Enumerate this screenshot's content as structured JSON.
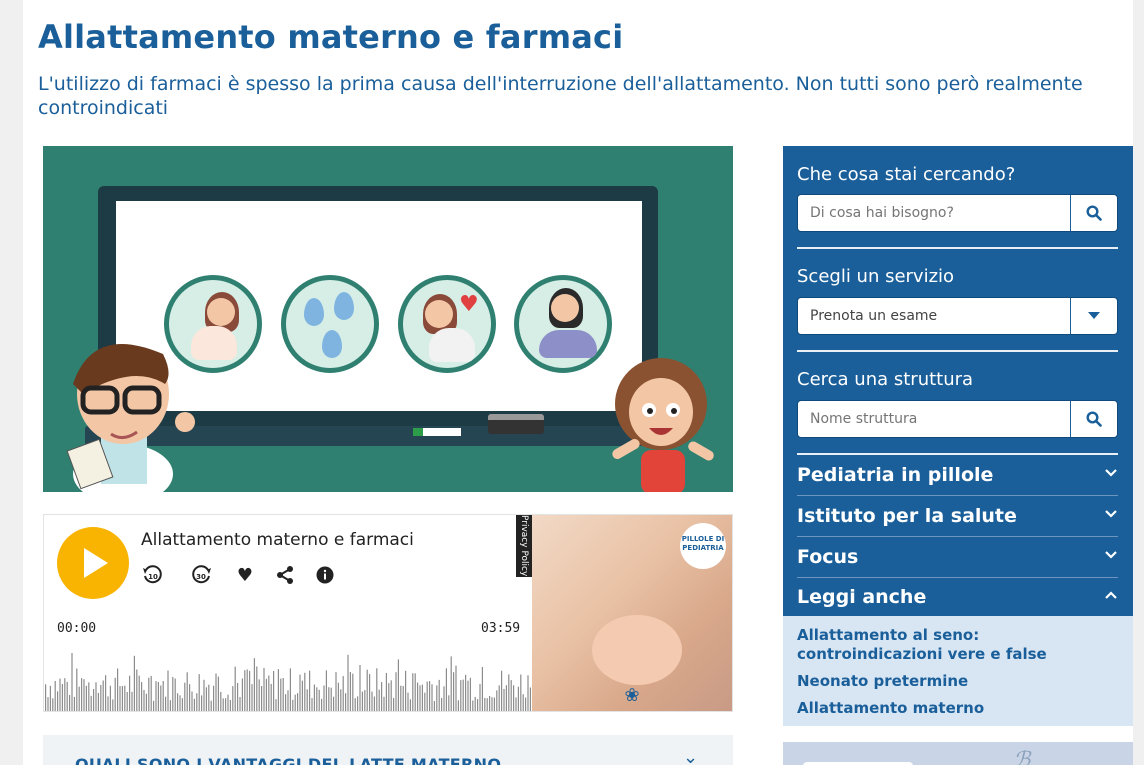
{
  "article": {
    "title": "Allattamento materno e farmaci",
    "subtitle": "L'utilizzo di farmaci è spesso la prima causa dell'interruzione dell'allattamento. Non tutti sono però realmente controindicati"
  },
  "audio": {
    "title": "Allattamento materno e farmaci",
    "current_time": "00:00",
    "duration": "03:59",
    "privacy_label": "Privacy Policy",
    "controls": [
      "play-icon",
      "rewind-10-icon",
      "forward-30-icon",
      "heart-icon",
      "share-icon",
      "info-icon"
    ],
    "thumbnail_logo": "PILLOLE DI PEDIATRIA",
    "accent": "#f8b400"
  },
  "accordion": {
    "label": "QUALI SONO I VANTAGGI DEL LATTE MATERNO"
  },
  "sidebar": {
    "search": {
      "label": "Che cosa stai cercando?",
      "placeholder": "Di cosa hai bisogno?"
    },
    "service": {
      "label": "Scegli un servizio",
      "selected": "Prenota un esame"
    },
    "structure": {
      "label": "Cerca una struttura",
      "placeholder": "Nome struttura"
    },
    "menus": [
      {
        "label": "Pediatria in pillole",
        "expanded": false
      },
      {
        "label": "Istituto per la salute",
        "expanded": false
      },
      {
        "label": "Focus",
        "expanded": false
      },
      {
        "label": "Leggi anche",
        "expanded": true
      }
    ],
    "read_more": [
      "Allattamento al seno: controindicazioni vere e false",
      "Neonato pretermine",
      "Allattamento materno"
    ]
  },
  "colors": {
    "brand": "#1a5f9a",
    "sidebar_bg": "#1a5f9a",
    "read_more_bg": "#d8e6f4",
    "hero_bg": "#2f8070"
  }
}
